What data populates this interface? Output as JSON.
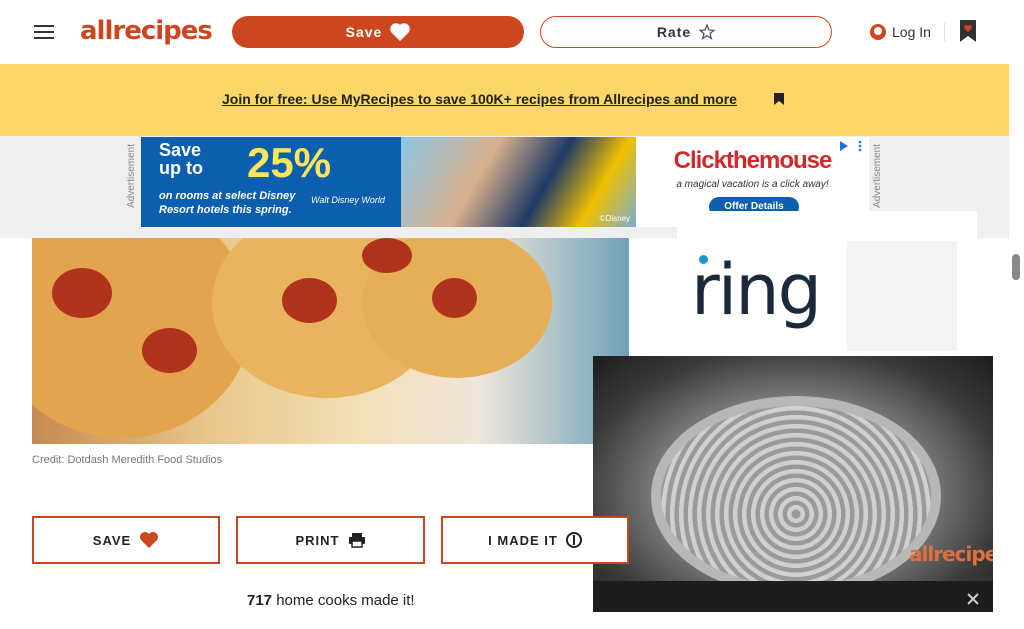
{
  "header": {
    "logo_text": "allrecipes",
    "save_label": "Save",
    "rate_label": "Rate",
    "login_label": "Log In"
  },
  "banner": {
    "link_text": "Join for free: Use MyRecipes to save 100K+ recipes from Allrecipes and more"
  },
  "ad_top": {
    "label": "Advertisement",
    "save_line1": "Save",
    "save_line2": "up to",
    "percent": "25%",
    "promo_line1": "on rooms at select Disney",
    "promo_line2": "Resort hotels this spring.",
    "partner": "Walt Disney World",
    "brand": "Clickthemouse",
    "tagline": "a magical vacation is a click away!",
    "offer_button": "Offer Details",
    "copyright": "©Disney"
  },
  "ad_right": {
    "brand": "ring"
  },
  "hero": {
    "credit": "Credit: Dotdash Meredith Food Studios"
  },
  "video": {
    "brand": "allrecipes"
  },
  "actions": {
    "save_label": "SAVE",
    "print_label": "PRINT",
    "made_label": "I MADE IT"
  },
  "made_it": {
    "count": "717",
    "text": "home cooks made it!"
  },
  "colors": {
    "brand": "#ce4620",
    "banner": "#fcd767",
    "ring_blue": "#1998d5"
  },
  "icons": [
    "menu-icon",
    "heart-icon",
    "star-icon",
    "user-icon",
    "bookmark-heart-icon",
    "close-icon",
    "print-icon",
    "hands-icon",
    "ad-choices-icon"
  ]
}
